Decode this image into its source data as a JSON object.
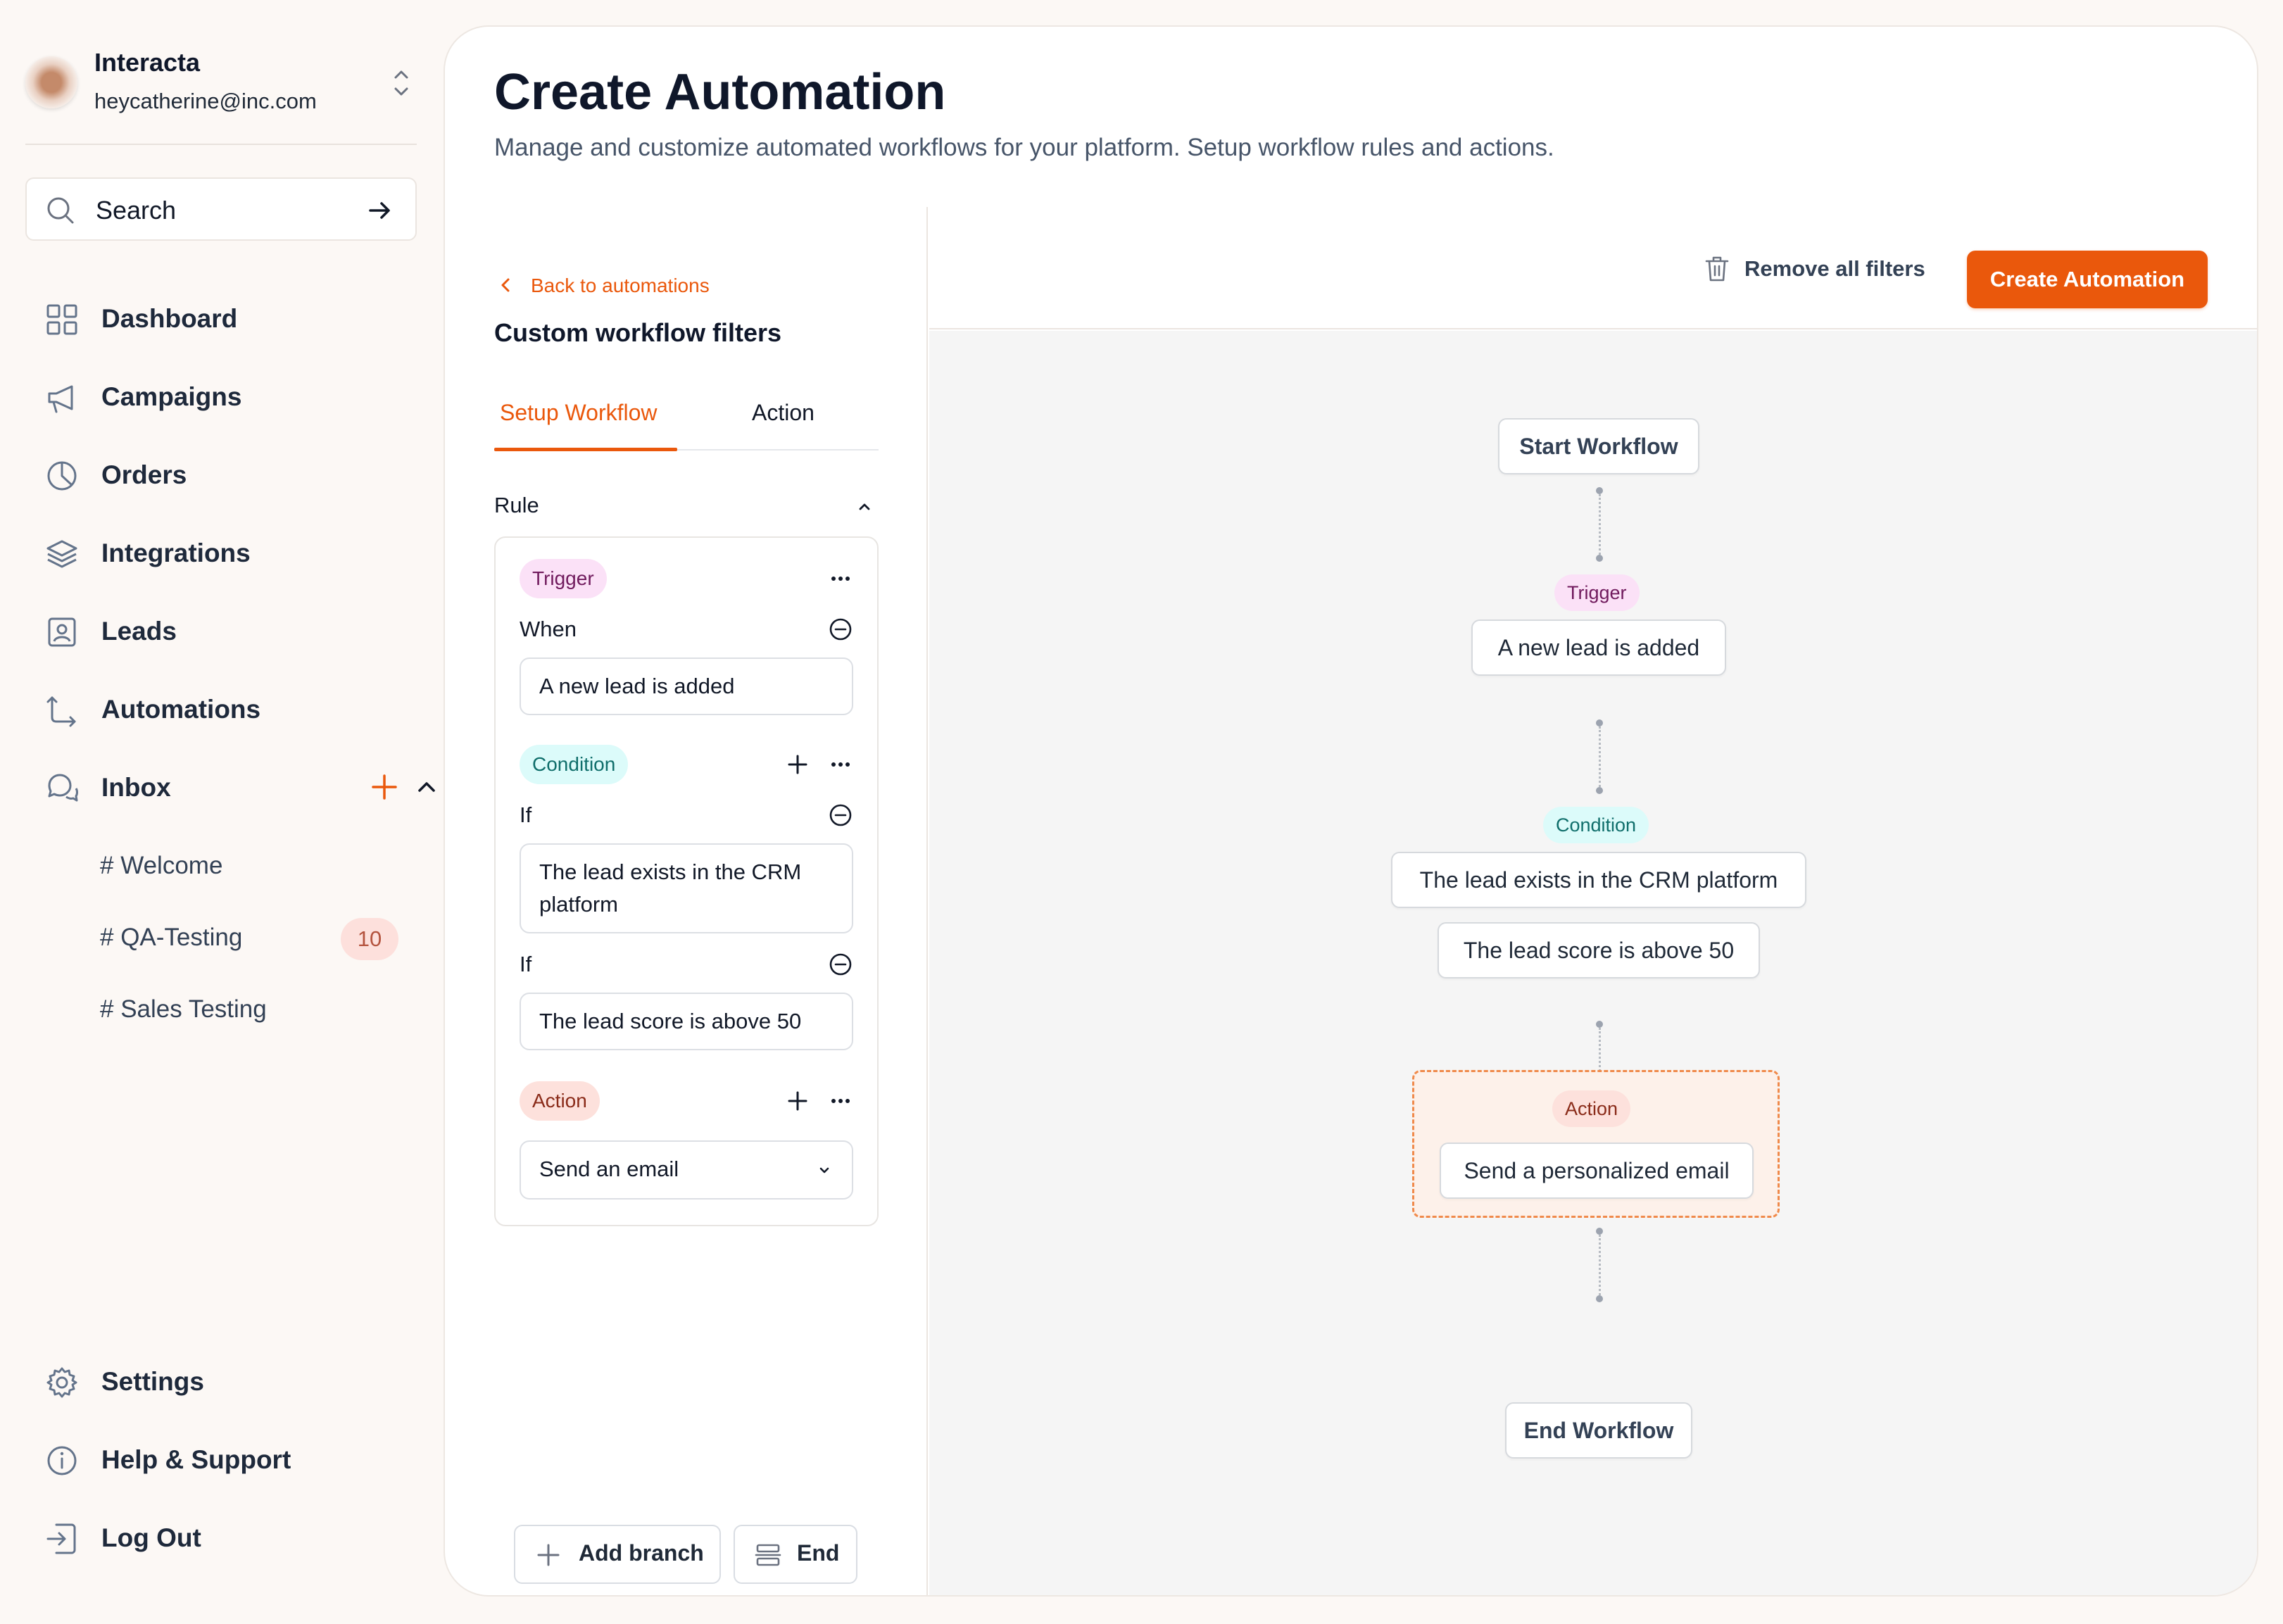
{
  "account": {
    "name": "Interacta",
    "email": "heycatherine@inc.com"
  },
  "search": {
    "label": "Search"
  },
  "nav": {
    "dashboard": "Dashboard",
    "campaigns": "Campaigns",
    "orders": "Orders",
    "integrations": "Integrations",
    "leads": "Leads",
    "automations": "Automations",
    "inbox": "Inbox",
    "channels": [
      {
        "label": "# Welcome"
      },
      {
        "label": "# QA-Testing",
        "badge": "10"
      },
      {
        "label": "# Sales Testing"
      }
    ],
    "settings": "Settings",
    "help": "Help & Support",
    "logout": "Log Out"
  },
  "page": {
    "title": "Create Automation",
    "subtitle": "Manage and customize automated workflows for your platform. Setup workflow rules and actions."
  },
  "panel": {
    "back_label": "Back to automations",
    "title": "Custom workflow filters",
    "tabs": [
      "Setup Workflow",
      "Action"
    ],
    "rule_label": "Rule",
    "trigger": {
      "pill": "Trigger",
      "label": "When",
      "value": "A new lead is added"
    },
    "condition": {
      "pill": "Condition",
      "rows": [
        {
          "label": "If",
          "value": "The lead exists in the CRM platform"
        },
        {
          "label": "If",
          "value": "The lead score is above 50"
        }
      ]
    },
    "action": {
      "pill": "Action",
      "value": "Send an email"
    },
    "add_branch": "Add branch",
    "end": "End"
  },
  "toolbar": {
    "remove_filters": "Remove all filters",
    "create": "Create Automation"
  },
  "flow": {
    "start": "Start Workflow",
    "trigger_pill": "Trigger",
    "trigger_node": "A new lead is added",
    "condition_pill": "Condition",
    "condition_nodes": [
      "The lead exists in the CRM platform",
      "The lead score is above 50"
    ],
    "action_pill": "Action",
    "action_node": "Send a personalized email",
    "end": "End Workflow"
  },
  "colors": {
    "accent": "#ea580c",
    "badge_bg": "#fde0dc"
  }
}
